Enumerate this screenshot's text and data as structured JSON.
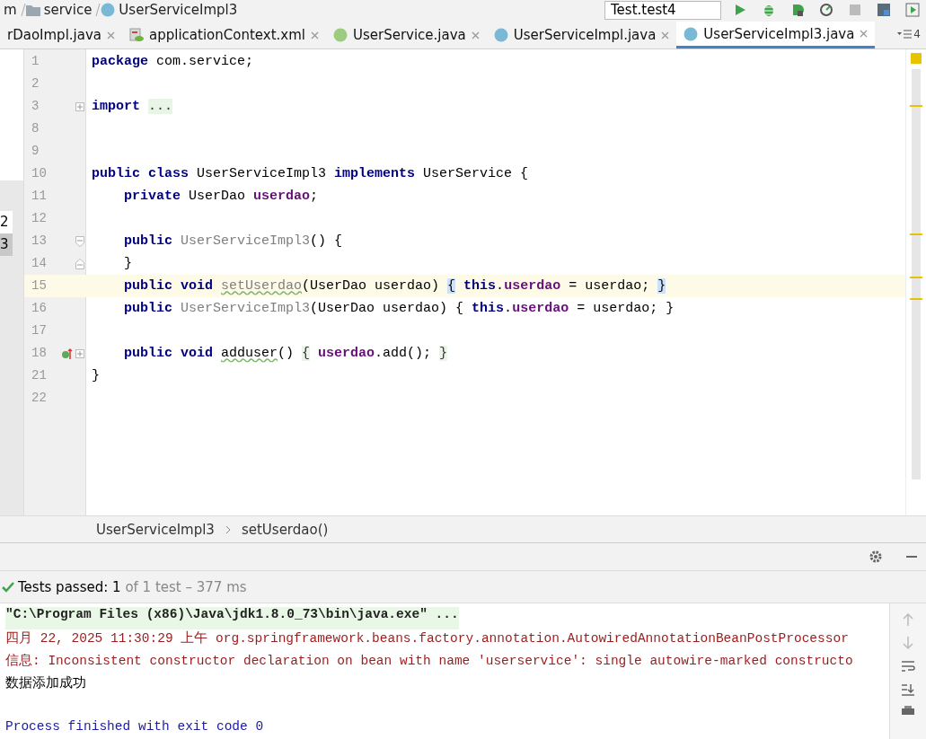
{
  "nav_bar": {
    "crumbs": [
      {
        "label": "m",
        "kind": "text"
      },
      {
        "label": "service",
        "kind": "folder"
      },
      {
        "label": "UserServiceImpl3",
        "kind": "class"
      }
    ],
    "run_config": "Test.test4"
  },
  "tabs": [
    {
      "label": "rDaoImpl.java",
      "kind": "none",
      "selected": false
    },
    {
      "label": "applicationContext.xml",
      "kind": "xml",
      "selected": false
    },
    {
      "label": "UserService.java",
      "kind": "interface",
      "selected": false
    },
    {
      "label": "UserServiceImpl.java",
      "kind": "class",
      "selected": false
    },
    {
      "label": "UserServiceImpl3.java",
      "kind": "class",
      "selected": true
    }
  ],
  "tab_overflow": "4",
  "left_strip": [
    {
      "label": "2",
      "selected": false
    },
    {
      "label": "3",
      "selected": true
    }
  ],
  "lines": [
    {
      "number": "1",
      "tokens": [
        {
          "t": "package",
          "kind": "keyword"
        },
        {
          "t": " com.service;",
          "kind": "plain"
        }
      ]
    },
    {
      "number": "2"
    },
    {
      "number": "3",
      "fold": {
        "kind": "plus"
      },
      "tokens": [
        {
          "t": "import ",
          "kind": "keyword"
        },
        {
          "t": "...",
          "kind": "folded"
        }
      ]
    },
    {
      "number": "8"
    },
    {
      "number": "9"
    },
    {
      "number": "10",
      "tokens": [
        {
          "t": "public class",
          "kind": "keyword"
        },
        {
          "t": " UserServiceImpl3 ",
          "kind": "plain"
        },
        {
          "t": "implements",
          "kind": "keyword"
        },
        {
          "t": " UserService {",
          "kind": "plain"
        }
      ]
    },
    {
      "number": "11",
      "tokens": [
        {
          "t": "    private",
          "kind": "keyword"
        },
        {
          "t": " UserDao ",
          "kind": "plain"
        },
        {
          "t": "userdao",
          "kind": "field"
        },
        {
          "t": ";",
          "kind": "plain"
        }
      ]
    },
    {
      "number": "12"
    },
    {
      "number": "13",
      "fold": {
        "kind": "start"
      },
      "tokens": [
        {
          "t": "    public ",
          "kind": "keyword"
        },
        {
          "t": "UserServiceImpl3",
          "kind": "unused"
        },
        {
          "t": "() {",
          "kind": "plain"
        }
      ]
    },
    {
      "number": "14",
      "fold": {
        "kind": "end"
      },
      "tokens": [
        {
          "t": "    }",
          "kind": "plain"
        }
      ]
    },
    {
      "number": "15",
      "current": true,
      "tokens": [
        {
          "t": "    public void ",
          "kind": "keyword"
        },
        {
          "t": "setUserdao",
          "kind": "unused-wavy"
        },
        {
          "t": "(UserDao userdao) ",
          "kind": "plain"
        },
        {
          "t": "{",
          "kind": "brace"
        },
        {
          "t": " this",
          "kind": "keyword"
        },
        {
          "t": ".",
          "kind": "plain"
        },
        {
          "t": "userdao",
          "kind": "field"
        },
        {
          "t": " = userdao; ",
          "kind": "plain"
        },
        {
          "t": "}",
          "kind": "brace"
        }
      ]
    },
    {
      "number": "16",
      "tokens": [
        {
          "t": "    public ",
          "kind": "keyword"
        },
        {
          "t": "UserServiceImpl3",
          "kind": "unused"
        },
        {
          "t": "(UserDao userdao) { ",
          "kind": "plain"
        },
        {
          "t": "this",
          "kind": "keyword"
        },
        {
          "t": ".",
          "kind": "plain"
        },
        {
          "t": "userdao",
          "kind": "field"
        },
        {
          "t": " = userdao; }",
          "kind": "plain"
        }
      ]
    },
    {
      "number": "17"
    },
    {
      "number": "18",
      "marker": {
        "kind": "implements"
      },
      "fold": {
        "kind": "plus"
      },
      "tokens": [
        {
          "t": "    public void ",
          "kind": "keyword"
        },
        {
          "t": "adduser",
          "kind": "wavy"
        },
        {
          "t": "() ",
          "kind": "plain"
        },
        {
          "t": "{",
          "kind": "folded"
        },
        {
          "t": " userdao",
          "kind": "field"
        },
        {
          "t": ".add(); ",
          "kind": "plain"
        },
        {
          "t": "}",
          "kind": "folded"
        }
      ]
    },
    {
      "number": "21",
      "tokens": [
        {
          "t": "}",
          "kind": "plain"
        }
      ]
    },
    {
      "number": "22"
    }
  ],
  "breadcrumbs": [
    "UserServiceImpl3",
    "setUserdao()"
  ],
  "test_status": {
    "label": "Tests passed:",
    "count": "1",
    "detail": "of 1 test – 377 ms"
  },
  "console": [
    {
      "kind": "cmd",
      "text": "\"C:\\Program Files (x86)\\Java\\jdk1.8.0_73\\bin\\java.exe\" ..."
    },
    {
      "kind": "err",
      "text": "四月 22, 2025 11:30:29 上午 org.springframework.beans.factory.annotation.AutowiredAnnotationBeanPostProcessor"
    },
    {
      "kind": "err",
      "text": "信息: Inconsistent constructor declaration on bean with name 'userservice': single autowire-marked constructo"
    },
    {
      "kind": "out",
      "text": "数据添加成功"
    },
    {
      "kind": "blank"
    },
    {
      "kind": "exit",
      "text": "Process finished with exit code 0"
    }
  ]
}
